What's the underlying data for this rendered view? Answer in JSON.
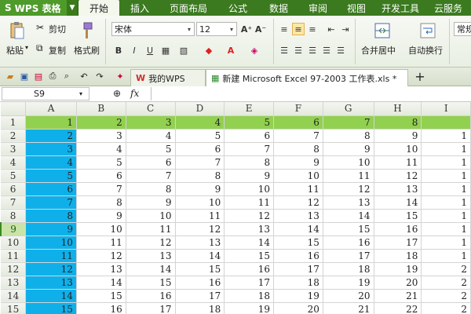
{
  "app": {
    "logo": "S",
    "name": "WPS 表格",
    "arrow": "▼"
  },
  "menu": [
    "开始",
    "插入",
    "页面布局",
    "公式",
    "数据",
    "审阅",
    "视图",
    "开发工具",
    "云服务"
  ],
  "ribbon": {
    "paste": "粘贴",
    "cut": "剪切",
    "copy": "复制",
    "format_painter": "格式刷",
    "font_name": "宋体",
    "font_size": "12",
    "bold": "B",
    "italic": "I",
    "underline": "U",
    "merge": "合并居中",
    "wrap": "自动换行",
    "number_format": "常规",
    "font_up": "A⁺",
    "font_down": "A⁻"
  },
  "tabs": {
    "wps_tab": "我的WPS",
    "file_tab": "新建 Microsoft Excel 97-2003 工作表.xls *",
    "new_tab": "+"
  },
  "formula_bar": {
    "cell_ref": "S9",
    "fx": "fx",
    "value": ""
  },
  "columns": [
    "A",
    "B",
    "C",
    "D",
    "E",
    "F",
    "G",
    "H",
    "I"
  ],
  "rows": [
    {
      "n": "1",
      "v": [
        "1",
        "2",
        "3",
        "4",
        "5",
        "6",
        "7",
        "8",
        ""
      ]
    },
    {
      "n": "2",
      "v": [
        "2",
        "3",
        "4",
        "5",
        "6",
        "7",
        "8",
        "9",
        "1"
      ]
    },
    {
      "n": "3",
      "v": [
        "3",
        "4",
        "5",
        "6",
        "7",
        "8",
        "9",
        "10",
        "1"
      ]
    },
    {
      "n": "4",
      "v": [
        "4",
        "5",
        "6",
        "7",
        "8",
        "9",
        "10",
        "11",
        "1"
      ]
    },
    {
      "n": "5",
      "v": [
        "5",
        "6",
        "7",
        "8",
        "9",
        "10",
        "11",
        "12",
        "1"
      ]
    },
    {
      "n": "6",
      "v": [
        "6",
        "7",
        "8",
        "9",
        "10",
        "11",
        "12",
        "13",
        "1"
      ]
    },
    {
      "n": "7",
      "v": [
        "7",
        "8",
        "9",
        "10",
        "11",
        "12",
        "13",
        "14",
        "1"
      ]
    },
    {
      "n": "8",
      "v": [
        "8",
        "9",
        "10",
        "11",
        "12",
        "13",
        "14",
        "15",
        "1"
      ]
    },
    {
      "n": "9",
      "v": [
        "9",
        "10",
        "11",
        "12",
        "13",
        "14",
        "15",
        "16",
        "1"
      ]
    },
    {
      "n": "10",
      "v": [
        "10",
        "11",
        "12",
        "13",
        "14",
        "15",
        "16",
        "17",
        "1"
      ]
    },
    {
      "n": "11",
      "v": [
        "11",
        "12",
        "13",
        "14",
        "15",
        "16",
        "17",
        "18",
        "1"
      ]
    },
    {
      "n": "12",
      "v": [
        "12",
        "13",
        "14",
        "15",
        "16",
        "17",
        "18",
        "19",
        "2"
      ]
    },
    {
      "n": "13",
      "v": [
        "13",
        "14",
        "15",
        "16",
        "17",
        "18",
        "19",
        "20",
        "2"
      ]
    },
    {
      "n": "14",
      "v": [
        "14",
        "15",
        "16",
        "17",
        "18",
        "19",
        "20",
        "21",
        "2"
      ]
    },
    {
      "n": "15",
      "v": [
        "15",
        "16",
        "17",
        "18",
        "19",
        "20",
        "21",
        "22",
        "2"
      ]
    }
  ],
  "active_row": "9",
  "colors": {
    "brand": "#3b7a1f",
    "colA": "#0fb0ea",
    "row1": "#92d050"
  }
}
